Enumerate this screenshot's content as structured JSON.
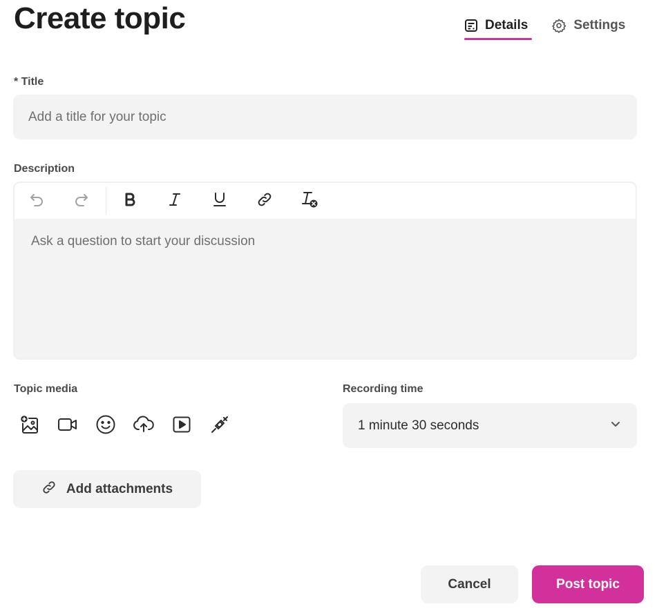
{
  "page": {
    "title": "Create topic"
  },
  "tabs": [
    {
      "label": "Details",
      "icon": "details-icon",
      "active": true
    },
    {
      "label": "Settings",
      "icon": "gear-icon",
      "active": false
    }
  ],
  "title_field": {
    "label": "* Title",
    "placeholder": "Add a title for your topic",
    "value": ""
  },
  "description": {
    "label": "Description",
    "placeholder": "Ask a question to start your discussion",
    "toolbar": [
      "undo-icon",
      "redo-icon",
      "bold-icon",
      "italic-icon",
      "underline-icon",
      "link-icon",
      "clear-format-icon"
    ]
  },
  "topic_media": {
    "label": "Topic media",
    "icons": [
      "add-image-icon",
      "video-camera-icon",
      "smiley-icon",
      "cloud-upload-icon",
      "play-video-icon",
      "plug-icon"
    ]
  },
  "recording_time": {
    "label": "Recording time",
    "value": "1 minute 30 seconds"
  },
  "attachments": {
    "label": "Add attachments"
  },
  "actions": {
    "cancel_label": "Cancel",
    "post_label": "Post topic"
  },
  "colors": {
    "accent": "#d2309a",
    "field_bg": "#f3f3f3",
    "text": "#2b2b2b"
  }
}
